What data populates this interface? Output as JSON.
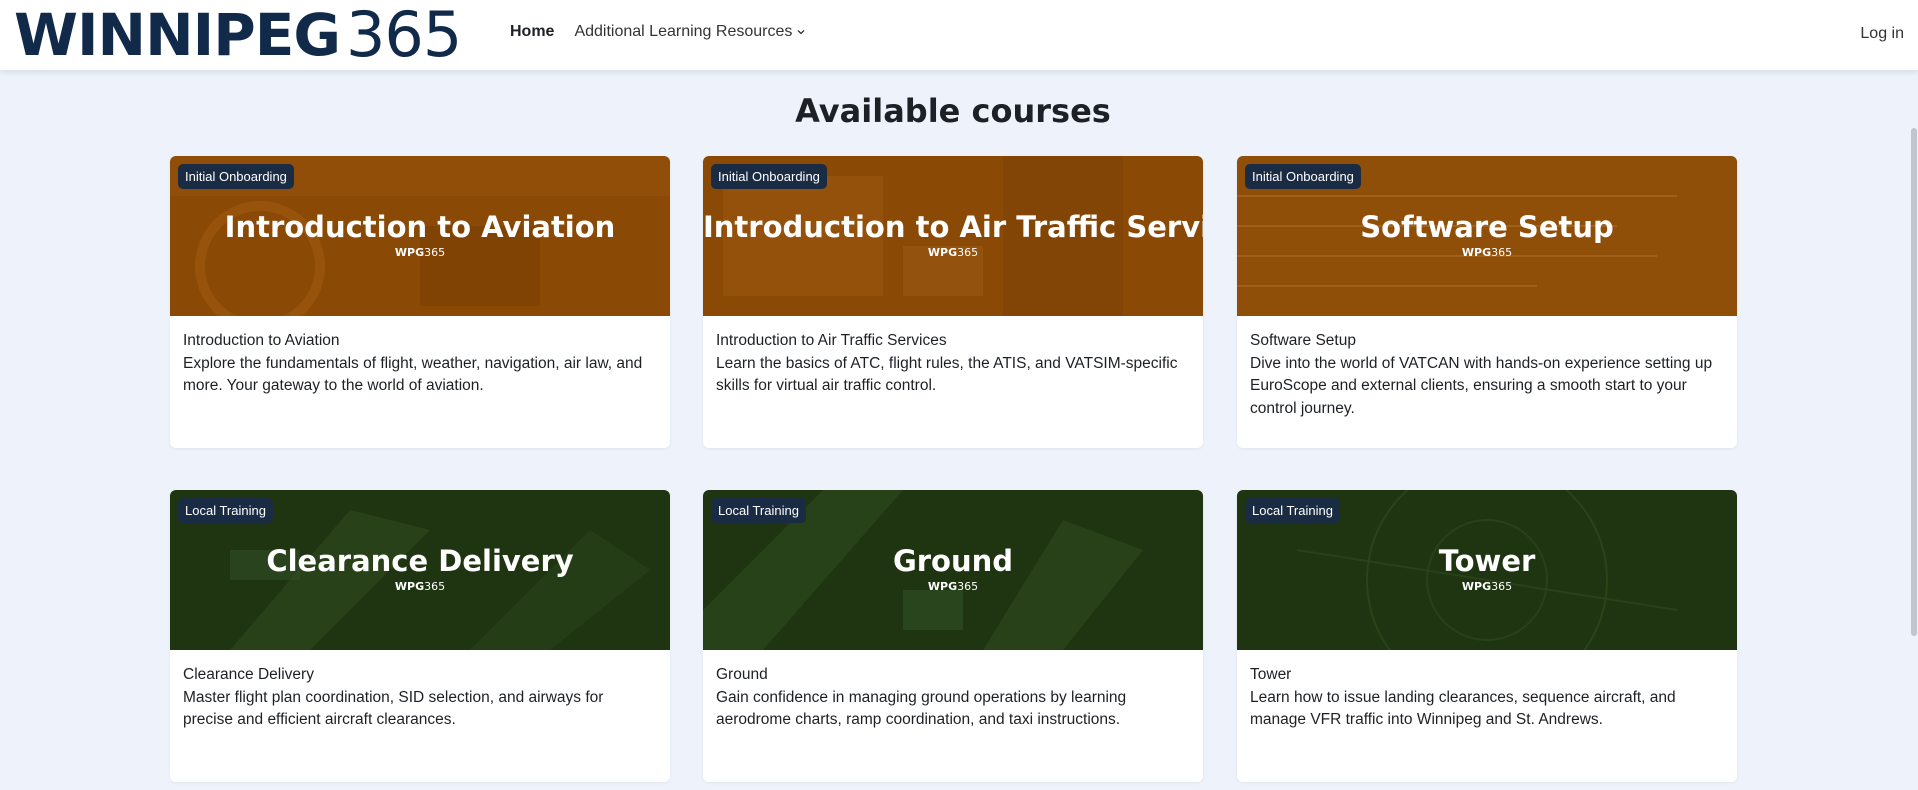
{
  "header": {
    "logo_main": "WINNIPEG",
    "logo_num": "365",
    "nav": {
      "home": "Home",
      "resources": "Additional Learning Resources"
    },
    "login": "Log in"
  },
  "main": {
    "title": "Available courses",
    "banner_logo_bold": "WPG",
    "banner_logo_num": "365",
    "courses": [
      {
        "badge": "Initial Onboarding",
        "banner": "Introduction to Aviation",
        "name": "Introduction to Aviation",
        "description": "Explore the fundamentals of flight, weather, navigation, air law, and more. Your gateway to the world of aviation.",
        "theme": "orange"
      },
      {
        "badge": "Initial Onboarding",
        "banner": "Introduction to Air Traffic Services",
        "name": "Introduction to Air Traffic Services",
        "description": "Learn the basics of ATC, flight rules, the ATIS, and VATSIM-specific skills for virtual air traffic control.",
        "theme": "orange"
      },
      {
        "badge": "Initial Onboarding",
        "banner": "Software Setup",
        "name": "Software Setup",
        "description": "Dive into the world of VATCAN with hands-on experience setting up EuroScope and external clients, ensuring a smooth start to your control journey.",
        "theme": "orange"
      },
      {
        "badge": "Local Training",
        "banner": "Clearance Delivery",
        "name": "Clearance Delivery",
        "description": "Master flight plan coordination, SID selection, and airways for precise and efficient aircraft clearances.",
        "theme": "green"
      },
      {
        "badge": "Local Training",
        "banner": "Ground",
        "name": "Ground",
        "description": "Gain confidence in managing ground operations by learning aerodrome charts, ramp coordination, and taxi instructions.",
        "theme": "green"
      },
      {
        "badge": "Local Training",
        "banner": "Tower",
        "name": "Tower",
        "description": "Learn how to issue landing clearances, sequence aircraft, and manage VFR traffic into Winnipeg and St. Andrews.",
        "theme": "green"
      }
    ]
  },
  "colors": {
    "brand_navy": "#112a4a",
    "orange_banner": "#8a4a06",
    "green_banner": "#1f3512",
    "badge_bg": "#1a2b44",
    "page_bg": "#eef3fb"
  },
  "icons": {
    "dropdown": "chevron-down-icon"
  }
}
